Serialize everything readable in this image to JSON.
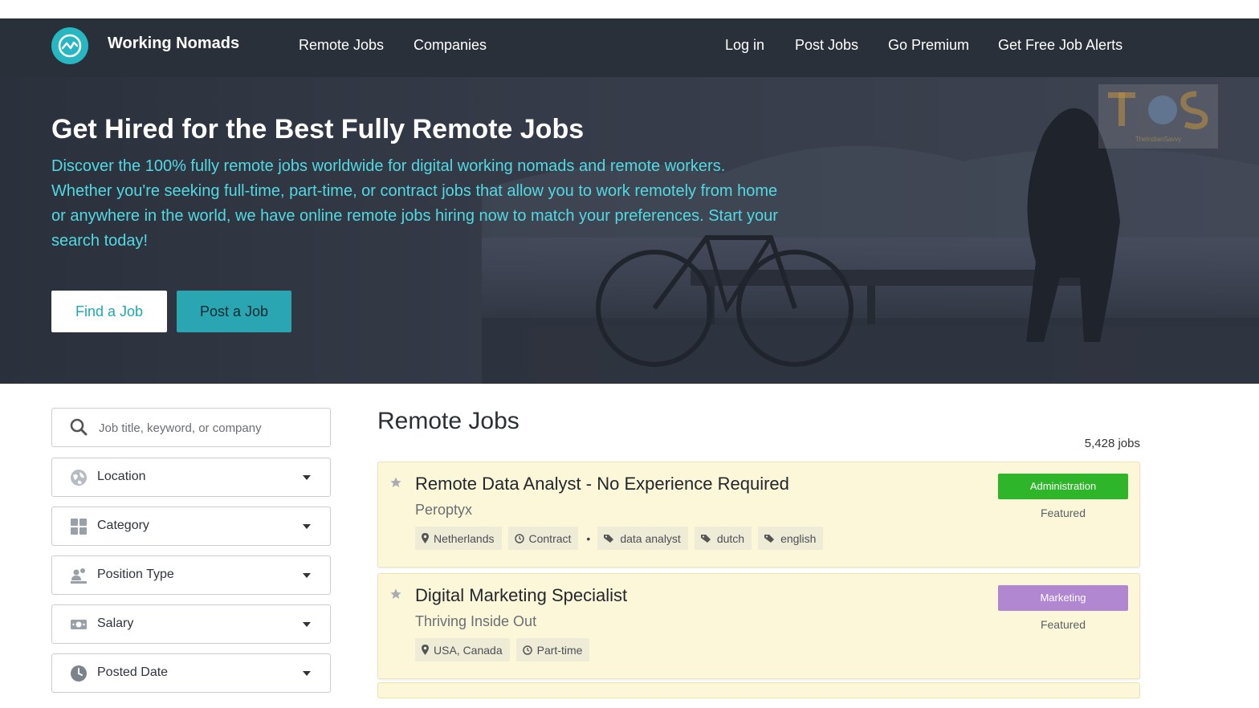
{
  "nav": {
    "brand": "Working Nomads",
    "left_links": [
      "Remote Jobs",
      "Companies"
    ],
    "right_links": [
      "Log in",
      "Post Jobs",
      "Go Premium",
      "Get Free Job Alerts"
    ]
  },
  "hero": {
    "title": "Get Hired for the Best Fully Remote Jobs",
    "description": "Discover the 100% fully remote jobs worldwide for digital working nomads and remote workers. Whether you're seeking full-time, part-time, or contract jobs that allow you to work remotely from home or anywhere in the world, we have online remote jobs hiring now to match your preferences. Start your search today!",
    "find_button": "Find a Job",
    "post_button": "Post a Job",
    "watermark_text": "TheIndianSavvy"
  },
  "sidebar": {
    "search_placeholder": "Job title, keyword, or company",
    "filters": [
      {
        "label": "Location",
        "icon": "globe-icon"
      },
      {
        "label": "Category",
        "icon": "grid-icon"
      },
      {
        "label": "Position Type",
        "icon": "people-icon"
      },
      {
        "label": "Salary",
        "icon": "money-icon"
      },
      {
        "label": "Posted Date",
        "icon": "clock-icon"
      }
    ]
  },
  "main": {
    "title": "Remote Jobs",
    "count": "5,428 jobs",
    "jobs": [
      {
        "title": "Remote Data Analyst - No Experience Required",
        "company": "Peroptyx",
        "badge": "Administration",
        "badge_color": "#2eb52a",
        "featured": "Featured",
        "location": "Netherlands",
        "type": "Contract",
        "tags": [
          "data analyst",
          "dutch",
          "english"
        ]
      },
      {
        "title": "Digital Marketing Specialist",
        "company": "Thriving Inside Out",
        "badge": "Marketing",
        "badge_color": "#b187d1",
        "featured": "Featured",
        "location": "USA, Canada",
        "type": "Part-time",
        "tags": []
      }
    ]
  },
  "colors": {
    "navbar": "#2a3039",
    "accent": "#27b7c3",
    "hero_text": "#52d9e2",
    "card_bg": "#fcf7d8"
  }
}
